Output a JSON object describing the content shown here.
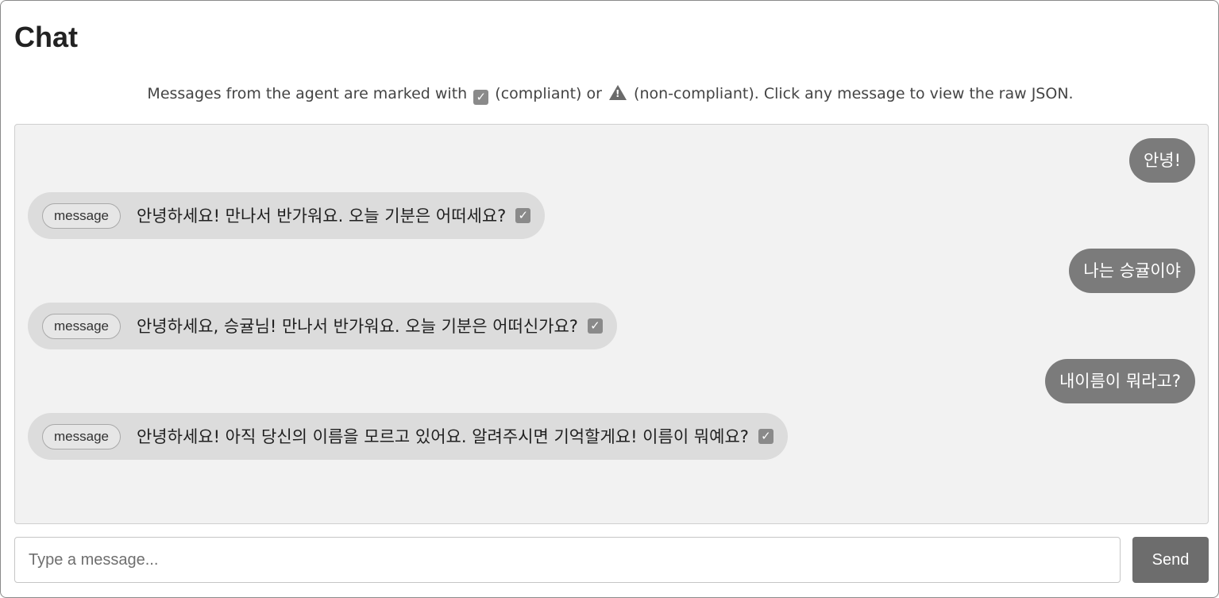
{
  "header": {
    "title": "Chat"
  },
  "intro": {
    "part1": "Messages from the agent are marked with",
    "part2": "(compliant) or",
    "part3": "(non-compliant). Click any message to view the raw JSON.",
    "compliant_icon": "check-box-icon",
    "noncompliant_icon": "warning-icon"
  },
  "conversation": {
    "messages": [
      {
        "role": "user",
        "text": "안녕!"
      },
      {
        "role": "agent",
        "type": "message",
        "text": "안녕하세요! 만나서 반가워요. 오늘 기분은 어떠세요?",
        "status": "compliant"
      },
      {
        "role": "user",
        "text": "나는 승귤이야"
      },
      {
        "role": "agent",
        "type": "message",
        "text": "안녕하세요, 승귤님! 만나서 반가워요. 오늘 기분은 어떠신가요?",
        "status": "compliant"
      },
      {
        "role": "user",
        "text": "내이름이 뭐라고?"
      },
      {
        "role": "agent",
        "type": "message",
        "text": "안녕하세요! 아직 당신의 이름을 모르고 있어요. 알려주시면 기억할게요! 이름이 뭐예요?",
        "status": "compliant"
      }
    ]
  },
  "composer": {
    "placeholder": "Type a message...",
    "value": "",
    "send_label": "Send"
  },
  "colors": {
    "user_bubble": "#7b7b7b",
    "agent_bubble": "#dcdcdc",
    "chat_background": "#f2f2f2",
    "send_button": "#6d6d6d"
  }
}
